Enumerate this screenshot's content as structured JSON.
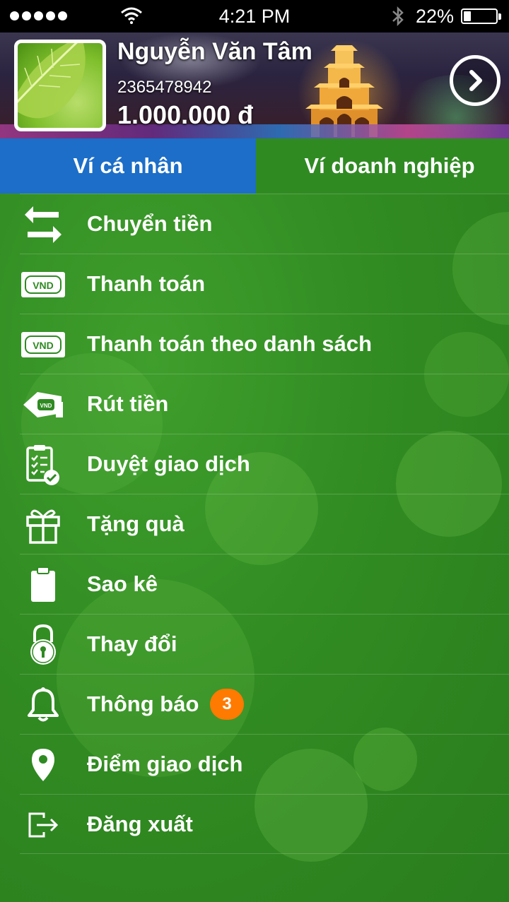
{
  "status_bar": {
    "time": "4:21 PM",
    "battery_percent": "22%",
    "battery_level": 0.22,
    "signal_dots": 5,
    "icons": [
      "wifi-icon",
      "bluetooth-icon",
      "battery-icon"
    ]
  },
  "header": {
    "name": "Nguyễn Văn Tâm",
    "account_number": "2365478942",
    "balance": "1.000.000 đ",
    "next_icon": "chevron-right-circle-icon"
  },
  "tabs": [
    {
      "label": "Ví cá nhân",
      "active": true
    },
    {
      "label": "Ví doanh nghiệp",
      "active": false
    }
  ],
  "menu": [
    {
      "label": "Chuyển tiền",
      "icon": "transfer-arrows-icon"
    },
    {
      "label": "Thanh toán",
      "icon": "vnd-banknote-icon"
    },
    {
      "label": "Thanh toán theo danh sách",
      "icon": "vnd-banknote-icon"
    },
    {
      "label": "Rút tiền",
      "icon": "withdraw-cash-icon"
    },
    {
      "label": "Duyệt giao dịch",
      "icon": "clipboard-check-icon"
    },
    {
      "label": "Tặng quà",
      "icon": "gift-icon"
    },
    {
      "label": "Sao kê",
      "icon": "clipboard-icon"
    },
    {
      "label": "Thay đổi",
      "icon": "lock-icon"
    },
    {
      "label": "Thông báo",
      "icon": "bell-icon",
      "badge": "3"
    },
    {
      "label": "Điểm giao dịch",
      "icon": "location-pin-icon"
    },
    {
      "label": "Đăng xuất",
      "icon": "logout-icon"
    }
  ],
  "colors": {
    "tab_active": "#1c6ec8",
    "background": "#2f8a22",
    "badge": "#ff7a00"
  },
  "tab_vnd_text": "VND"
}
